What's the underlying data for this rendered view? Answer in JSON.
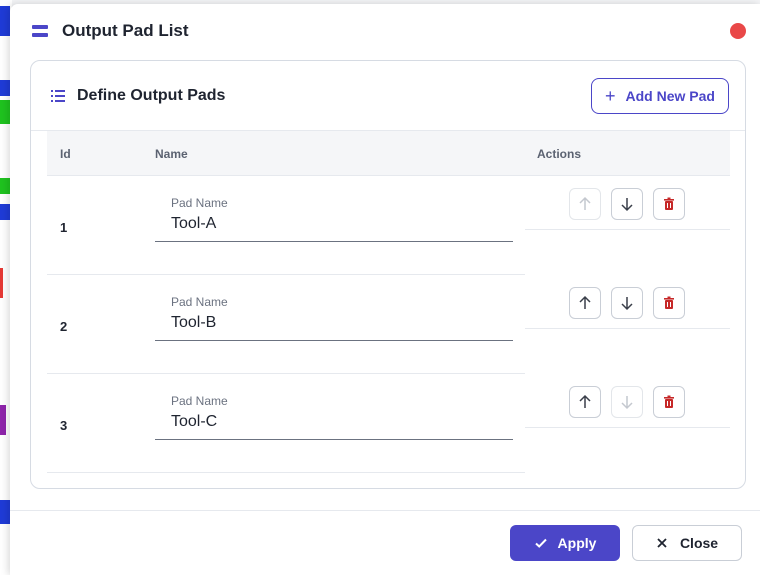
{
  "dialog": {
    "title": "Output Pad List",
    "title_icon": "menu-icon",
    "close_icon": "close-dot-icon"
  },
  "card": {
    "title": "Define Output Pads",
    "title_icon": "list-icon",
    "add_button": {
      "icon": "plus-icon",
      "label": "Add New Pad"
    }
  },
  "table": {
    "columns": {
      "id": "Id",
      "name": "Name",
      "actions": "Actions"
    },
    "rows": [
      {
        "id": "1",
        "label": "Pad Name",
        "value": "Tool-A",
        "up_enabled": false,
        "down_enabled": true
      },
      {
        "id": "2",
        "label": "Pad Name",
        "value": "Tool-B",
        "up_enabled": true,
        "down_enabled": true
      },
      {
        "id": "3",
        "label": "Pad Name",
        "value": "Tool-C",
        "up_enabled": true,
        "down_enabled": false
      }
    ],
    "action_icons": [
      "arrow-up-icon",
      "arrow-down-icon",
      "trash-icon"
    ]
  },
  "footer": {
    "apply": {
      "icon": "check-icon",
      "label": "Apply"
    },
    "close": {
      "icon": "x-icon",
      "label": "Close"
    }
  },
  "colors": {
    "accent": "#4b46c8",
    "danger": "#c62828",
    "close_dot": "#e94848",
    "disabled_icon": "#c4c8cf",
    "icon": "#3a3f4a"
  }
}
